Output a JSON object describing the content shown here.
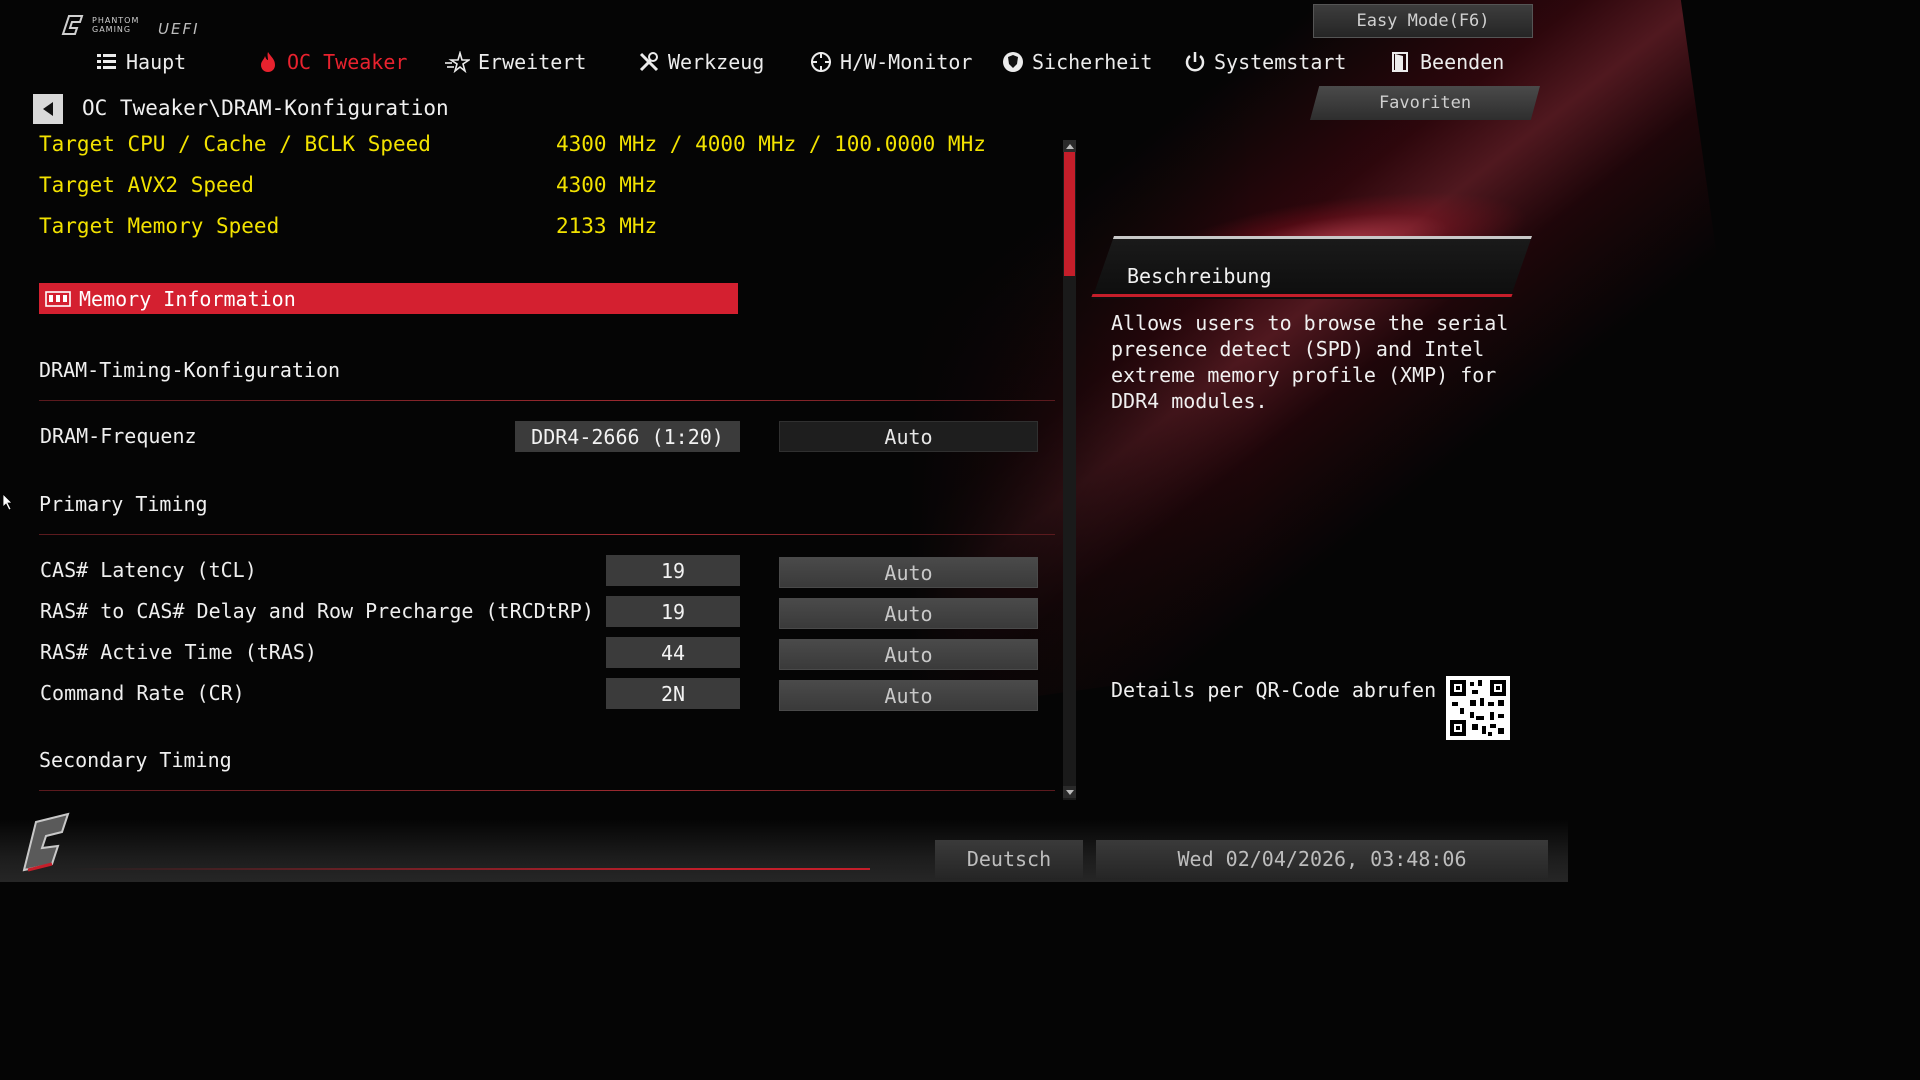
{
  "app": {
    "brand_text": "PHANTOM GAMING",
    "uefi_label": "UEFI",
    "easy_mode_label": "Easy Mode(F6)"
  },
  "nav": {
    "items": [
      {
        "label": "Haupt",
        "icon": "list-icon"
      },
      {
        "label": "OC Tweaker",
        "icon": "flame-icon",
        "active": true
      },
      {
        "label": "Erweitert",
        "icon": "star-icon"
      },
      {
        "label": "Werkzeug",
        "icon": "tools-icon"
      },
      {
        "label": "H/W-Monitor",
        "icon": "crosshair-icon"
      },
      {
        "label": "Sicherheit",
        "icon": "shield-icon"
      },
      {
        "label": "Systemstart",
        "icon": "power-icon"
      },
      {
        "label": "Beenden",
        "icon": "exit-door-icon"
      }
    ]
  },
  "breadcrumb": "OC Tweaker\\DRAM-Konfiguration",
  "favorites_label": "Favoriten",
  "info": [
    {
      "label": "Target CPU / Cache / BCLK Speed",
      "value": "4300 MHz / 4000 MHz / 100.0000 MHz"
    },
    {
      "label": "Target AVX2 Speed",
      "value": "4300 MHz"
    },
    {
      "label": "Target Memory Speed",
      "value": "2133 MHz"
    }
  ],
  "memory_information_label": "Memory Information",
  "sections": {
    "dram_timing": "DRAM-Timing-Konfiguration",
    "primary": "Primary Timing",
    "secondary": "Secondary Timing"
  },
  "dram_frequency": {
    "label": "DRAM-Frequenz",
    "current": "DDR4-2666 (1:20)",
    "option": "Auto"
  },
  "timings": [
    {
      "label": "CAS# Latency (tCL)",
      "current": "19",
      "option": "Auto"
    },
    {
      "label": "RAS# to CAS# Delay and Row Precharge (tRCDtRP)",
      "current": "19",
      "option": "Auto"
    },
    {
      "label": "RAS# Active Time (tRAS)",
      "current": "44",
      "option": "Auto"
    },
    {
      "label": "Command Rate (CR)",
      "current": "2N",
      "option": "Auto"
    }
  ],
  "description": {
    "title": "Beschreibung",
    "text": "Allows users to browse the serial\npresence detect (SPD) and Intel\nextreme memory profile (XMP) for\nDDR4 modules.",
    "qr_label": "Details per QR-Code abrufen"
  },
  "footer": {
    "language": "Deutsch",
    "datetime": "Wed 02/04/2026, 03:48:06"
  },
  "colors": {
    "accent_red": "#d42030",
    "info_yellow": "#f2e200"
  }
}
